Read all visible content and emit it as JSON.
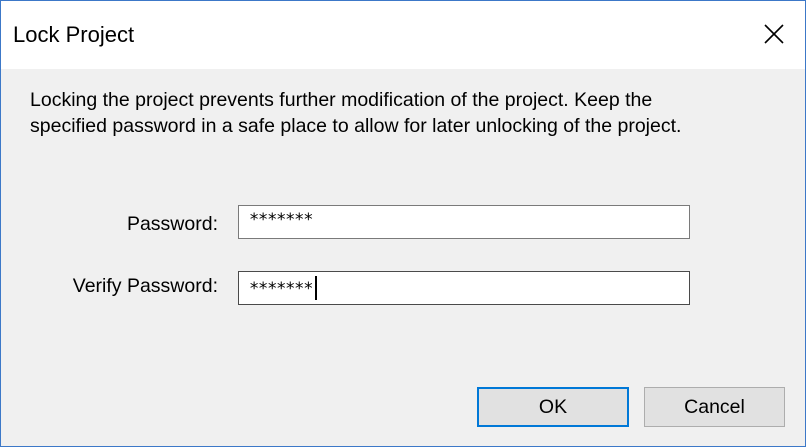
{
  "window": {
    "title": "Lock Project",
    "close_icon": "close-icon"
  },
  "description": {
    "line1": "Locking the project prevents further modification of the project. Keep the",
    "line2": "specified password in a safe place to allow for later unlocking of the project."
  },
  "form": {
    "password_label": "Password:",
    "password_value": "*******",
    "verify_label": "Verify Password:",
    "verify_value": "*******"
  },
  "buttons": {
    "ok_label": "OK",
    "cancel_label": "Cancel"
  },
  "colors": {
    "window_border": "#3c78c8",
    "dialog_background": "#f0f0f0",
    "default_button_border": "#0078d7"
  }
}
